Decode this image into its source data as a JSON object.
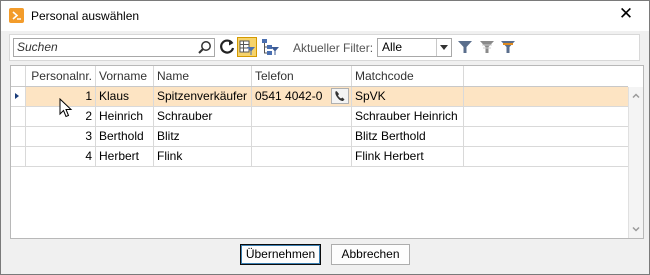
{
  "window": {
    "title": "Personal auswählen",
    "close_glyph": "✕"
  },
  "toolbar": {
    "search": {
      "value": "",
      "placeholder": "Suchen"
    },
    "icons": [
      "search-icon",
      "refresh-icon",
      "filter-grid-icon",
      "filter-tree-icon",
      "filter-icon",
      "filter-clear-icon",
      "filter-edit-icon"
    ],
    "filter_label": "Aktueller Filter:",
    "filter_value": "Alle"
  },
  "grid": {
    "columns": [
      "Personalnr.",
      "Vorname",
      "Name",
      "Telefon",
      "Matchcode"
    ],
    "rows": [
      {
        "personalnr": "1",
        "vorname": "Klaus",
        "name": "Spitzenverkäufer",
        "telefon": "0541 4042-0",
        "matchcode": "SpVK",
        "selected": true
      },
      {
        "personalnr": "2",
        "vorname": "Heinrich",
        "name": "Schrauber",
        "telefon": "",
        "matchcode": "Schrauber Heinrich",
        "selected": false
      },
      {
        "personalnr": "3",
        "vorname": "Berthold",
        "name": "Blitz",
        "telefon": "",
        "matchcode": "Blitz Berthold",
        "selected": false
      },
      {
        "personalnr": "4",
        "vorname": "Herbert",
        "name": "Flink",
        "telefon": "",
        "matchcode": "Flink Herbert",
        "selected": false
      }
    ]
  },
  "buttons": {
    "ok_label": "Übernehmen",
    "cancel_label": "Abbrechen"
  },
  "colors": {
    "selected_row": "#fde4c3",
    "app_icon": "#f39c2b",
    "active_tool": "#f6d36b",
    "filter_icon": "#5a6e8c"
  }
}
